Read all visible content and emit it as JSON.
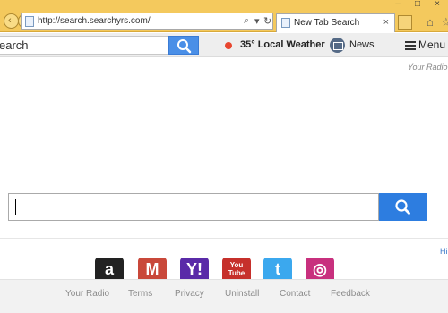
{
  "browser": {
    "address": "http://search.searchyrs.com/",
    "tab_title": "New Tab Search"
  },
  "toolbar": {
    "search_placeholder": "Search",
    "search_value": "earch",
    "weather": "35° Local Weather",
    "news": "News",
    "menu": "Menu"
  },
  "brand": "Your Radio",
  "main": {
    "hint_link": "Hi"
  },
  "tiles": [
    {
      "name": "amazon",
      "glyph": "a",
      "color": "#222222"
    },
    {
      "name": "gmail",
      "glyph": "M",
      "color": "#c9483a"
    },
    {
      "name": "yahoo",
      "glyph": "Y!",
      "color": "#5a2aa8"
    },
    {
      "name": "youtube",
      "glyph": "You Tube",
      "color": "#c6302b"
    },
    {
      "name": "twitter",
      "glyph": "t",
      "color": "#3ba8ee"
    },
    {
      "name": "instagram",
      "glyph": "◎",
      "color": "#c8307e"
    }
  ],
  "footer": {
    "links": [
      "Your Radio",
      "Terms",
      "Privacy",
      "Uninstall",
      "Contact",
      "Feedback"
    ]
  }
}
